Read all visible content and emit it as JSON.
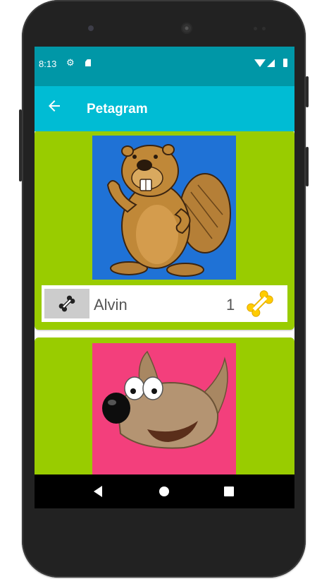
{
  "status_bar": {
    "time": "8:13",
    "icons": [
      "gear-icon",
      "sd-card-icon",
      "wifi-icon",
      "cell-signal-icon",
      "battery-icon"
    ]
  },
  "app_bar": {
    "title": "Petagram",
    "back_icon": "arrow-left-icon"
  },
  "pets": [
    {
      "name": "Alvin",
      "likes": "1",
      "photo": "cartoon beaver waving"
    },
    {
      "name": "",
      "likes": "",
      "photo": "cartoon dog head (wilber)"
    }
  ],
  "colors": {
    "status_bar": "#0097a7",
    "app_bar": "#00bcd4",
    "card": "#99cc00",
    "like_button": "#cccccc",
    "bone_gold": "#ffcc00"
  },
  "nav_bar": {
    "icons": [
      "nav-back-icon",
      "nav-home-icon",
      "nav-recents-icon"
    ]
  }
}
